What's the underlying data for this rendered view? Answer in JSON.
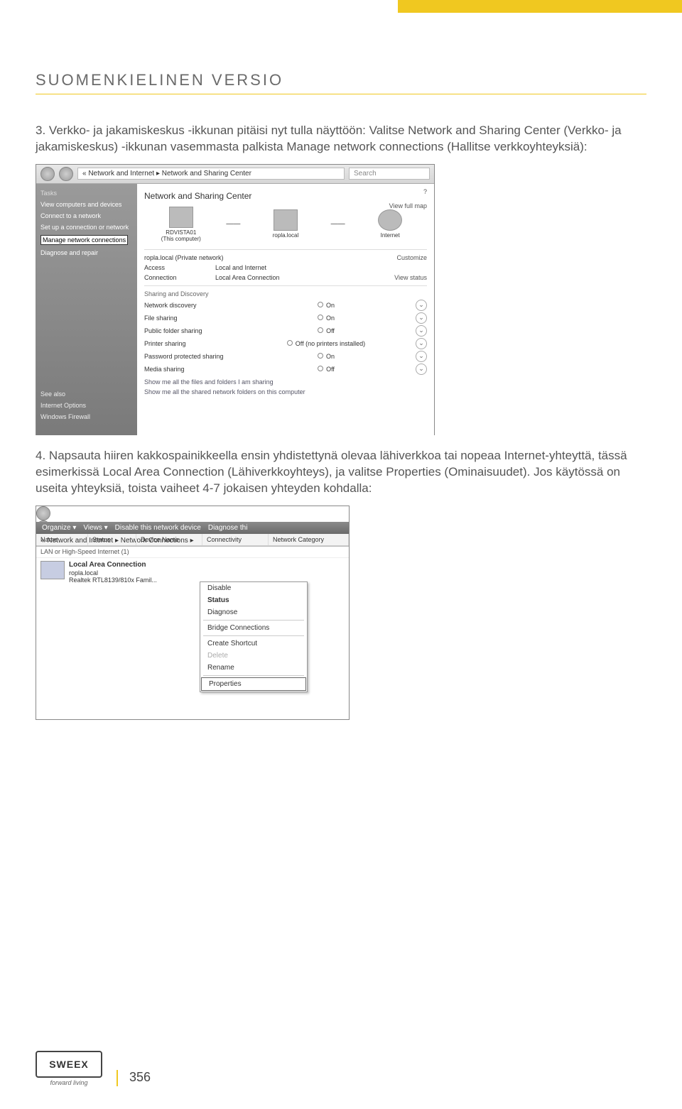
{
  "header": {
    "title": "SUOMENKIELINEN VERSIO"
  },
  "para1": {
    "num": "3.",
    "text": "Verkko- ja jakamiskeskus -ikkunan pitäisi nyt tulla näyttöön: Valitse Network and Sharing Center (Verkko- ja jakamiskeskus) -ikkunan vasemmasta palkista Manage network connections (Hallitse verkkoyhteyksiä):"
  },
  "ss1": {
    "breadcrumb": "« Network and Internet ▸ Network and Sharing Center",
    "search_ph": "Search",
    "sidebar": {
      "tasks": "Tasks",
      "items": [
        "View computers and devices",
        "Connect to a network",
        "Set up a connection or network"
      ],
      "highlight": "Manage network connections",
      "after": "Diagnose and repair",
      "seealso": "See also",
      "seealso_items": [
        "Internet Options",
        "Windows Firewall"
      ]
    },
    "main_title": "Network and Sharing Center",
    "viewmap": "View full map",
    "nodes": [
      {
        "label1": "RDVISTA01",
        "label2": "(This computer)"
      },
      {
        "label1": "ropla.local",
        "label2": ""
      },
      {
        "label1": "Internet",
        "label2": ""
      }
    ],
    "net_name": "ropla.local (Private network)",
    "customize": "Customize",
    "rows": [
      {
        "l": "Access",
        "m": "Local and Internet",
        "r": ""
      },
      {
        "l": "Connection",
        "m": "Local Area Connection",
        "r": "View status"
      }
    ],
    "sd_title": "Sharing and Discovery",
    "share": [
      {
        "l": "Network discovery",
        "v": "On"
      },
      {
        "l": "File sharing",
        "v": "On"
      },
      {
        "l": "Public folder sharing",
        "v": "Off"
      },
      {
        "l": "Printer sharing",
        "v": "Off (no printers installed)"
      },
      {
        "l": "Password protected sharing",
        "v": "On"
      },
      {
        "l": "Media sharing",
        "v": "Off"
      }
    ],
    "show1": "Show me all the files and folders I am sharing",
    "show2": "Show me all the shared network folders on this computer"
  },
  "para2": {
    "num": "4.",
    "text": "Napsauta hiiren kakkospainikkeella ensin yhdistettynä olevaa lähiverkkoa tai nopeaa Internet-yhteyttä, tässä esimerkissä Local Area Connection (Lähiverkkoyhteys), ja valitse Properties (Ominaisuudet). Jos käytössä on useita yhteyksiä, toista vaiheet 4-7 jokaisen yhteyden kohdalla:"
  },
  "ss2": {
    "breadcrumb": "« Network and Internet ▸ Network Connections ▸",
    "toolbar": [
      "Organize ▾",
      "Views ▾",
      "Disable this network device",
      "Diagnose thi"
    ],
    "cols": [
      "Name",
      "Status",
      "Device Name",
      "Connectivity",
      "Network Category"
    ],
    "group": "LAN or High-Speed Internet (1)",
    "conn": {
      "name": "Local Area Connection",
      "domain": "ropla.local",
      "device": "Realtek RTL8139/810x Famil..."
    },
    "menu": [
      "Disable",
      "Status",
      "Diagnose",
      "Bridge Connections",
      "Create Shortcut",
      "Delete",
      "Rename",
      "Properties"
    ]
  },
  "footer": {
    "logo": "SWEEX",
    "tagline": "forward living",
    "page": "356"
  }
}
